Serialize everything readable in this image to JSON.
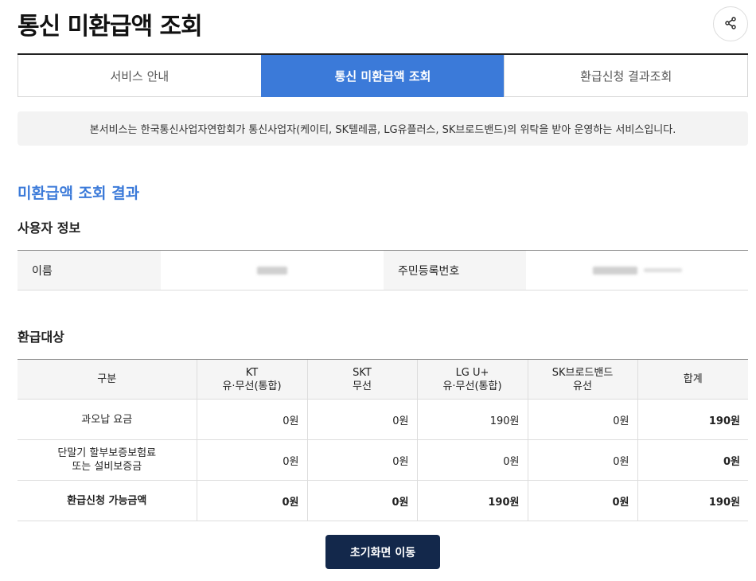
{
  "header": {
    "title": "통신 미환급액 조회",
    "share_icon": "share-icon"
  },
  "tabs": [
    {
      "label": "서비스 안내",
      "active": false
    },
    {
      "label": "통신 미환급액 조회",
      "active": true
    },
    {
      "label": "환급신청 결과조회",
      "active": false
    }
  ],
  "notice": "본서비스는 한국통신사업자연합회가 통신사업자(케이티, SK텔레콤, LG유플러스, SK브로드밴드)의 위탁을 받아 운영하는 서비스입니다.",
  "result_title": "미환급액 조회 결과",
  "user_info": {
    "title": "사용자 정보",
    "name_label": "이름",
    "id_label": "주민등록번호"
  },
  "refund": {
    "title": "환급대상",
    "headers": [
      {
        "line1": "구분",
        "line2": ""
      },
      {
        "line1": "KT",
        "line2": "유·무선(통합)"
      },
      {
        "line1": "SKT",
        "line2": "무선"
      },
      {
        "line1": "LG U+",
        "line2": "유·무선(통합)"
      },
      {
        "line1": "SK브로드밴드",
        "line2": "유선"
      },
      {
        "line1": "합계",
        "line2": ""
      }
    ],
    "rows": [
      {
        "label1": "과오납 요금",
        "label2": "",
        "cells": [
          "0원",
          "0원",
          "190원",
          "0원",
          "190원"
        ]
      },
      {
        "label1": "단말기 할부보증보험료",
        "label2": "또는 설비보증금",
        "cells": [
          "0원",
          "0원",
          "0원",
          "0원",
          "0원"
        ]
      },
      {
        "label1": "환급신청 가능금액",
        "label2": "",
        "cells": [
          "0원",
          "0원",
          "190원",
          "0원",
          "190원"
        ]
      }
    ]
  },
  "home_button": "초기화면 이동",
  "colors": {
    "accent": "#3b7ad9",
    "button": "#13284b"
  }
}
